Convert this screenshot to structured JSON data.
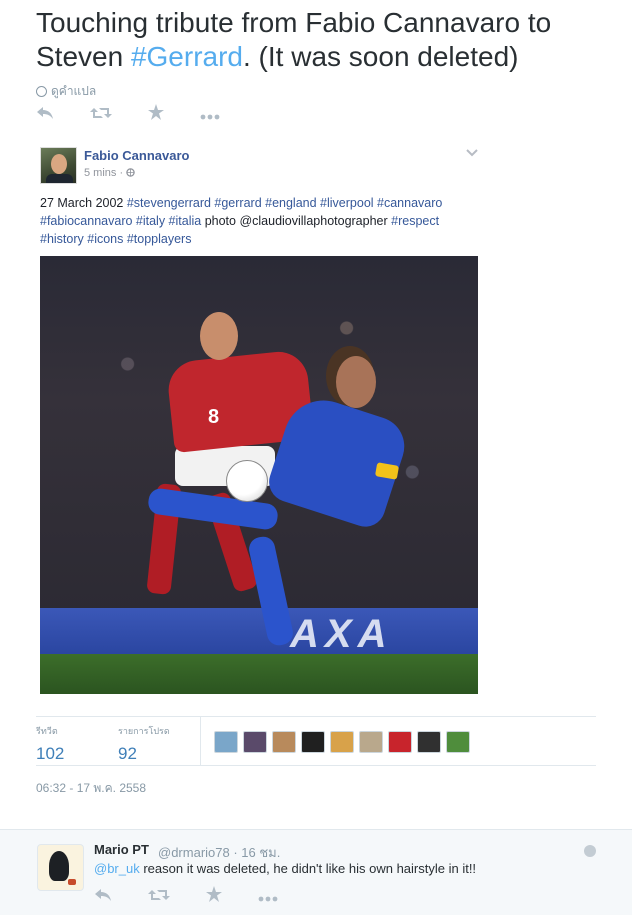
{
  "tweet": {
    "text_before": "Touching tribute from Fabio Cannavaro to Steven ",
    "hashtag": "#Gerrard",
    "text_after": ". (It was soon deleted)",
    "translate_label": "ดูคำแปล"
  },
  "embedded_post": {
    "author": "Fabio Cannavaro",
    "time": "5 mins ·",
    "body_prefix": "27 March 2002 ",
    "tags_line1": "#stevengerrard #gerrard #england #liverpool #cannavaro",
    "tags_line2a": "#fabiocannavaro #italy #italia",
    "photo_credit_word": " photo ",
    "photo_handle": "@claudiovillaphotographer",
    "tags_line2b": " #respect",
    "tags_line3": "#history #icons #topplayers",
    "photo": {
      "shirt_number": "8",
      "board_text": "AXA"
    }
  },
  "stats": {
    "retweets_label": "รีทวีต",
    "retweets": "102",
    "favorites_label": "รายการโปรด",
    "favorites": "92",
    "avatar_colors": [
      "#7aa6c9",
      "#5a4a6a",
      "#b88a5c",
      "#202020",
      "#d8a24a",
      "#b9a88c",
      "#c8242c",
      "#303030",
      "#4f8d3c"
    ]
  },
  "timestamp": "06:32 - 17 พ.ค. 2558",
  "reply": {
    "name": "Mario PT",
    "handle": "@drmario78 · 16 ชม.",
    "mention": "@br_uk",
    "text": " reason it was deleted, he didn't like his own hairstyle in it!!"
  },
  "icons": {
    "reply": "reply-icon",
    "retweet": "retweet-icon",
    "favorite": "star-icon",
    "more": "more-icon"
  }
}
